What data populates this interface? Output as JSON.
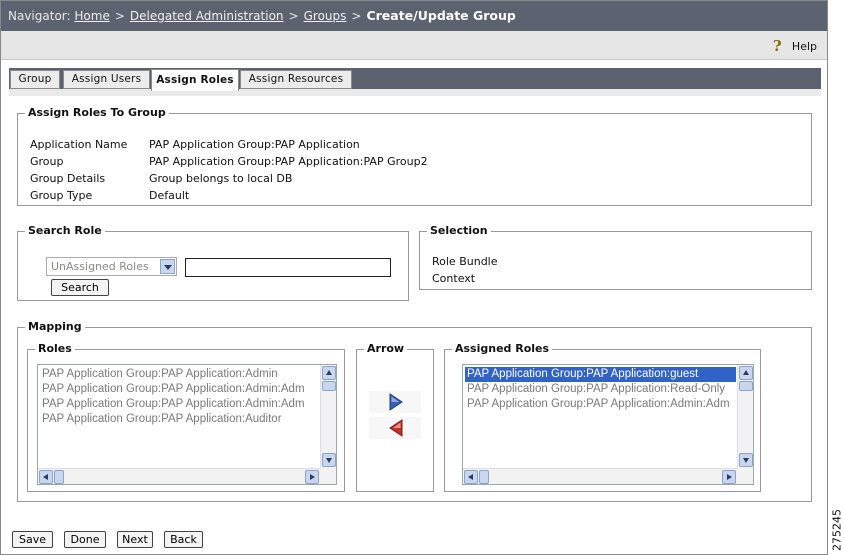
{
  "navigator": {
    "label": "Navigator:",
    "crumbs": [
      "Home",
      "Delegated Administration",
      "Groups"
    ],
    "separator": ">",
    "current": "Create/Update Group"
  },
  "help": {
    "label": "Help",
    "icon": "help-question-icon"
  },
  "tabs": [
    "Group",
    "Assign Users",
    "Assign Roles",
    "Assign Resources"
  ],
  "active_tab": "Assign Roles",
  "assign_section": {
    "legend": "Assign Roles To Group",
    "rows": [
      {
        "label": "Application Name",
        "value": "PAP Application Group:PAP Application"
      },
      {
        "label": "Group",
        "value": "PAP Application Group:PAP Application:PAP Group2"
      },
      {
        "label": "Group Details",
        "value": "Group belongs to local DB"
      },
      {
        "label": "Group Type",
        "value": "Default"
      }
    ]
  },
  "search_role": {
    "legend": "Search Role",
    "filter_selected": "UnAssigned Roles",
    "search_value": "",
    "search_button": "Search"
  },
  "selection": {
    "legend": "Selection",
    "labels": [
      "Role Bundle",
      "Context"
    ]
  },
  "mapping": {
    "legend": "Mapping",
    "roles": {
      "legend": "Roles",
      "items": [
        "PAP Application Group:PAP Application:Admin",
        "PAP Application Group:PAP Application:Admin:Adm",
        "PAP Application Group:PAP Application:Admin:Adm",
        "PAP Application Group:PAP Application:Auditor"
      ]
    },
    "arrow": {
      "legend": "Arrow",
      "add_icon": "arrow-right-icon",
      "remove_icon": "arrow-left-icon"
    },
    "assigned": {
      "legend": "Assigned Roles",
      "items": [
        "PAP Application Group:PAP Application:guest",
        "PAP Application Group:PAP Application:Read-Only",
        "PAP Application Group:PAP Application:Admin:Adm"
      ],
      "selected_index": 0
    }
  },
  "buttons": [
    "Save",
    "Done",
    "Next",
    "Back"
  ],
  "figure_number": "275245",
  "colors": {
    "nav_bg": "#5d6270",
    "selected_item": "#3163c6",
    "arrow_blue": "#3a5fb5",
    "arrow_red": "#c0302a"
  }
}
